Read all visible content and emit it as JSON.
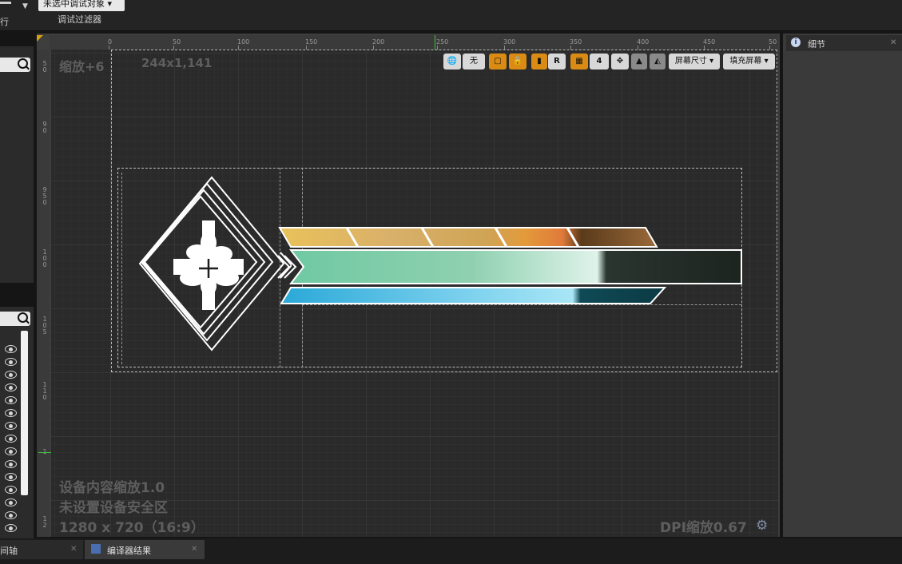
{
  "top_toolbar": {
    "left_label": "行",
    "debug_object": "未选中调试对象",
    "debug_filter_label": "调试过滤器"
  },
  "viewport": {
    "zoom": "缩放+6",
    "widget_size": "244x1,141",
    "device_content_scale": "设备内容缩放1.0",
    "safe_zone": "未设置设备安全区",
    "resolution": "1280 x 720（16:9）",
    "dpi_scale": "DPI缩放0.67",
    "ruler_top": [
      "0",
      "50",
      "100",
      "150",
      "200",
      "250",
      "300",
      "350",
      "400",
      "450",
      "50"
    ],
    "ruler_left": [
      "5\n0",
      "9\n0",
      "9\n5\n0",
      "1\n0\n0",
      "1\n0\n5",
      "1\n1\n0",
      "1",
      "1\n2"
    ],
    "toolbar": {
      "none_label": "无",
      "r_label": "R",
      "grid_value": "4",
      "screen_size_label": "屏幕尺寸",
      "fill_screen_label": "填充屏幕"
    }
  },
  "details_panel": {
    "title": "细节",
    "icon_letter": "i"
  },
  "bottom_tabs": {
    "timeline": "间轴",
    "compiler_results": "编译器结果"
  },
  "icons": [
    "search-icon",
    "eye-icon",
    "globe-icon",
    "lock-icon",
    "grid-icon",
    "gear-icon",
    "close-icon"
  ],
  "colors": {
    "accent_orange": "#d98b14",
    "canvas_bg": "#2a2a2a"
  }
}
